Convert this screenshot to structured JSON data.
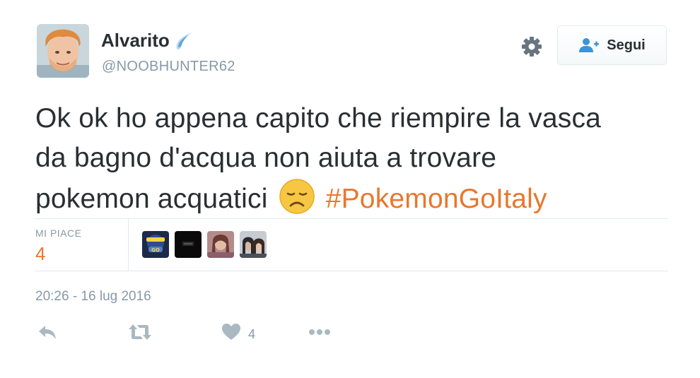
{
  "user": {
    "display_name": "Alvarito",
    "handle": "@NOOBHUNTER62",
    "avatar_icon": "avatar-photo",
    "name_badge_icon": "comet-icon"
  },
  "follow_button": {
    "label": "Segui",
    "icon": "add-user-icon"
  },
  "tweet": {
    "text_line1": "Ok ok ho appena capito che riempire la vasca",
    "text_line2": "da bagno d'acqua non aiuta a trovare",
    "text_line3": "pokemon acquatici",
    "emoji": "disappointed-face-emoji",
    "hashtag": "#PokemonGoItaly"
  },
  "stats": {
    "likes_label": "MI PIACE",
    "likes_count": "4"
  },
  "likers": [
    "liker-1",
    "liker-2",
    "liker-3",
    "liker-4"
  ],
  "timestamp": "20:26 - 16 lug 2016",
  "actions": {
    "reply_icon": "reply-icon",
    "retweet_icon": "retweet-icon",
    "like_icon": "heart-icon",
    "like_count": "4",
    "more_icon": "more-icon"
  },
  "colors": {
    "hashtag": "#e8772e",
    "muted": "#8899a6",
    "text": "#292f33",
    "divider": "#e1e8ed"
  }
}
